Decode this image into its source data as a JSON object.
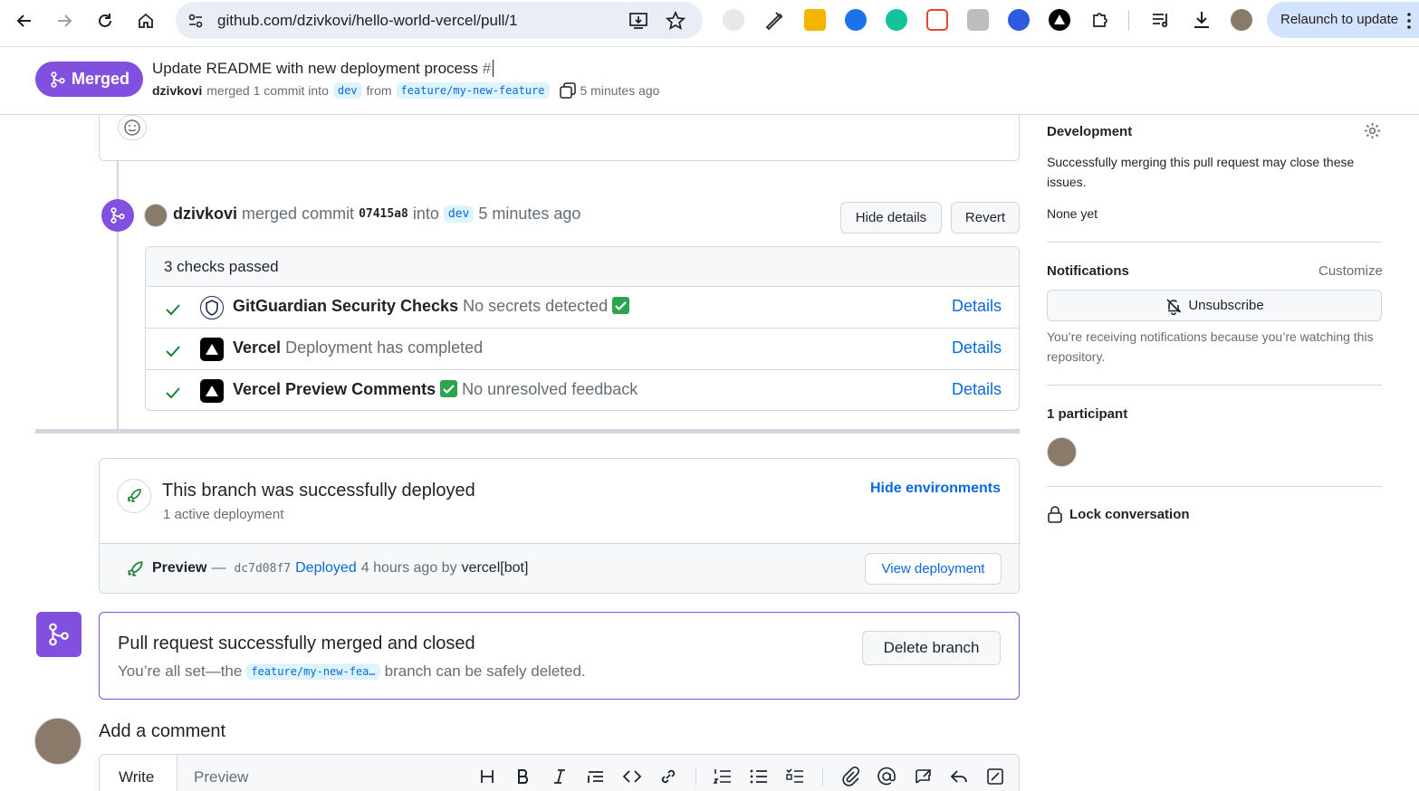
{
  "browser": {
    "url": "github.com/dzivkovi/hello-world-vercel/pull/1",
    "relaunch_label": "Relaunch to update"
  },
  "pr": {
    "status": "Merged",
    "title": "Update README with new deployment process",
    "number_prefix": "#",
    "author": "dzivkovi",
    "merged_text": "merged 1 commit into",
    "base_branch": "dev",
    "from_text": "from",
    "head_branch": "feature/my-new-feature",
    "time": "5 minutes ago"
  },
  "merge_event": {
    "author": "dzivkovi",
    "text1": "merged commit",
    "commit": "07415a8",
    "text2": "into",
    "branch": "dev",
    "time": "5 minutes ago",
    "hide_details": "Hide details",
    "revert": "Revert"
  },
  "checks": {
    "header": "3 checks passed",
    "details_label": "Details",
    "items": [
      {
        "name": "GitGuardian Security Checks",
        "desc": "No secrets detected"
      },
      {
        "name": "Vercel",
        "desc": "Deployment has completed"
      },
      {
        "name": "Vercel Preview Comments",
        "desc": "No unresolved feedback"
      }
    ]
  },
  "deployment": {
    "title": "This branch was successfully deployed",
    "subtitle": "1 active deployment",
    "hide_env": "Hide environments",
    "env": "Preview",
    "dash": "—",
    "sha": "dc7d08f7",
    "deployed": "Deployed",
    "time": "4 hours ago by",
    "by": "vercel[bot]",
    "view_button": "View deployment"
  },
  "merged_box": {
    "title": "Pull request successfully merged and closed",
    "text1": "You’re all set—the",
    "branch": "feature/my-new-fea…",
    "text2": "branch can be safely deleted.",
    "delete_button": "Delete branch"
  },
  "comment": {
    "heading": "Add a comment",
    "tab_write": "Write",
    "tab_preview": "Preview"
  },
  "sidebar": {
    "development": "Development",
    "dev_text": "Successfully merging this pull request may close these issues.",
    "none_yet": "None yet",
    "notifications": "Notifications",
    "customize": "Customize",
    "unsubscribe": "Unsubscribe",
    "notif_text": "You’re receiving notifications because you’re watching this repository.",
    "participants": "1 participant",
    "lock": "Lock conversation"
  },
  "colors": {
    "merged_purple": "#8250df",
    "link_blue": "#0969da",
    "success_green": "#1a7f37"
  }
}
